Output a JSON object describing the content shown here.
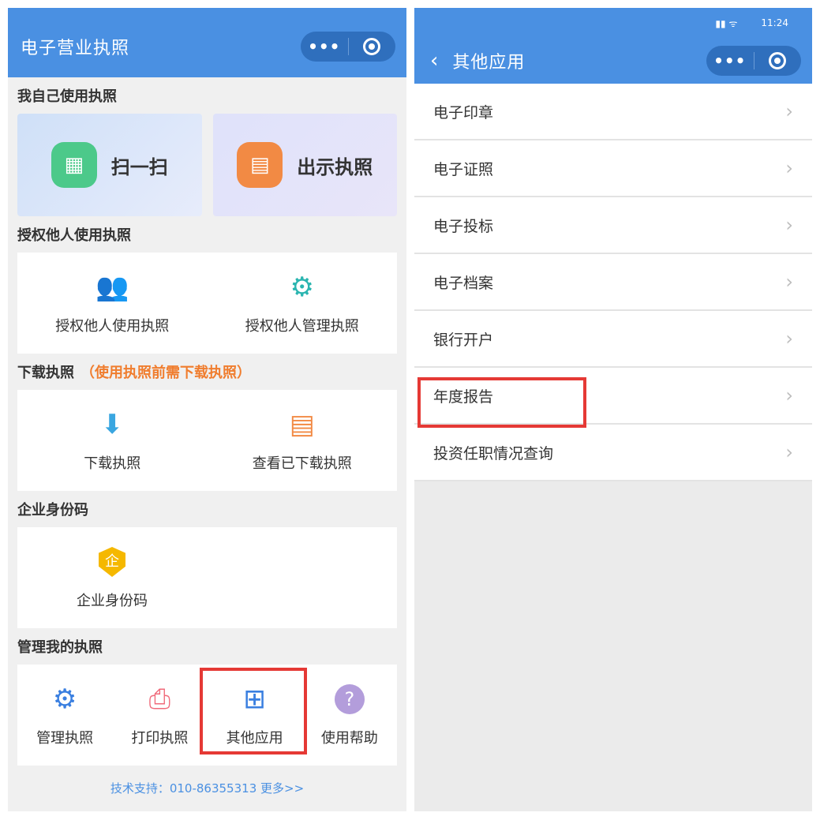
{
  "left": {
    "title": "电子营业执照",
    "capsule": {
      "more": "•••"
    },
    "section_self": "我自己使用执照",
    "scan_label": "扫一扫",
    "show_label": "出示执照",
    "section_authorize": "授权他人使用执照",
    "authorize_use": "授权他人使用执照",
    "authorize_manage": "授权他人管理执照",
    "section_download": "下载执照",
    "download_note": "（使用执照前需下载执照）",
    "download": "下载执照",
    "view_downloaded": "查看已下载执照",
    "section_code": "企业身份码",
    "enterprise_code": "企业身份码",
    "code_badge": "企",
    "section_manage": "管理我的执照",
    "manage": "管理执照",
    "print": "打印执照",
    "other_apps": "其他应用",
    "help": "使用帮助",
    "support": "技术支持：010-86355313  更多>>"
  },
  "right": {
    "status_time": "11:24",
    "back": "‹",
    "title": "其他应用",
    "capsule": {
      "more": "•••"
    },
    "items": [
      {
        "label": "电子印章"
      },
      {
        "label": "电子证照"
      },
      {
        "label": "电子投标"
      },
      {
        "label": "电子档案"
      },
      {
        "label": "银行开户"
      },
      {
        "label": "年度报告"
      },
      {
        "label": "投资任职情况查询"
      }
    ]
  },
  "colors": {
    "brand": "#4a90e2",
    "highlight": "#e53935",
    "warning": "#f07d2e"
  }
}
